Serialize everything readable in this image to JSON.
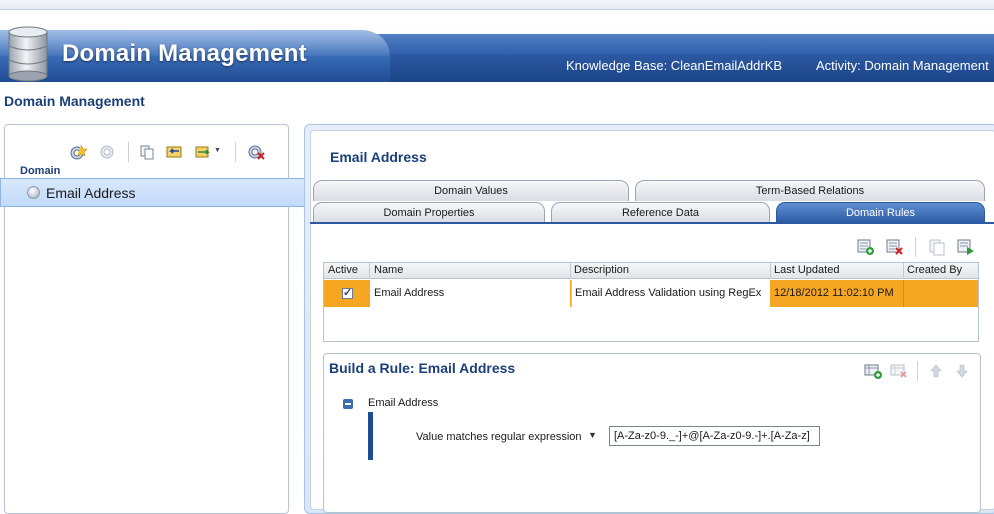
{
  "header": {
    "title": "Domain Management",
    "knowledge_base": "Knowledge Base: CleanEmailAddrKB",
    "activity": "Activity: Domain Management"
  },
  "page": {
    "title": "Domain Management"
  },
  "left_panel": {
    "domain_heading": "Domain",
    "domains": [
      {
        "label": "Email Address",
        "selected": true
      }
    ],
    "toolbar_icons": [
      "create-domain-icon",
      "create-composite-domain-icon",
      "copy-domain-icon",
      "import-domain-icon",
      "export-domain-icon",
      "delete-domain-icon"
    ]
  },
  "main": {
    "title": "Email Address",
    "tabs_row_top": [
      {
        "label": "Domain Values"
      },
      {
        "label": "Term-Based Relations"
      }
    ],
    "tabs_row_bottom": [
      {
        "label": "Domain Properties"
      },
      {
        "label": "Reference Data"
      },
      {
        "label": "Domain Rules",
        "active": true
      }
    ],
    "rule_toolbar_icons": [
      "add-rule-icon",
      "delete-rule-icon",
      "copy-rule-icon",
      "run-rule-icon"
    ]
  },
  "rules_grid": {
    "columns": [
      "Active",
      "Name",
      "Description",
      "Last Updated",
      "Created By"
    ],
    "rows": [
      {
        "active": true,
        "name": "Email Address",
        "description": "Email Address Validation using RegEx",
        "last_updated": "12/18/2012 11:02:10 PM",
        "created_by": ""
      }
    ]
  },
  "build_rule": {
    "title": "Build a Rule: Email Address",
    "clause_name": "Email Address",
    "condition_label": "Value matches regular expression",
    "condition_value": "[A-Za-z0-9._-]+@[A-Za-z0-9.-]+.[A-Za-z]",
    "toolbar_icons": [
      "add-clause-icon",
      "delete-clause-icon",
      "move-up-icon",
      "move-down-icon"
    ]
  },
  "colors": {
    "brand_blue": "#1f4b93",
    "selected_row": "#f5a623",
    "heading_text": "#1b3f78"
  }
}
